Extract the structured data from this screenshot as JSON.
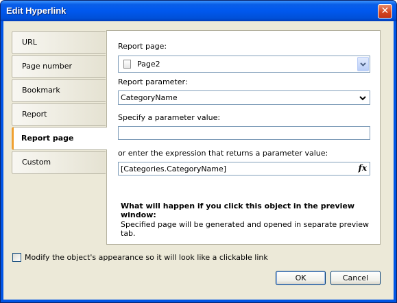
{
  "window": {
    "title": "Edit Hyperlink",
    "close_glyph": "✕"
  },
  "tabs": [
    {
      "label": "URL"
    },
    {
      "label": "Page number"
    },
    {
      "label": "Bookmark"
    },
    {
      "label": "Report"
    },
    {
      "label": "Report page",
      "active": true
    },
    {
      "label": "Custom"
    }
  ],
  "panel": {
    "report_page_label": "Report page:",
    "report_page_value": "Page2",
    "report_parameter_label": "Report parameter:",
    "report_parameter_value": "CategoryName",
    "param_value_label": "Specify a parameter value:",
    "param_value": "",
    "expression_label": "or enter the expression that returns a parameter value:",
    "expression_value": "[Categories.CategoryName]",
    "expression_button_glyph": "fx",
    "info_heading": "What will happen if you click this object in the preview window:",
    "info_text": "Specified page will be generated and opened in separate preview tab."
  },
  "options": {
    "modify_appearance_label": "Modify the object's appearance so it will look like a clickable link",
    "modify_appearance_checked": false
  },
  "buttons": {
    "ok": "OK",
    "cancel": "Cancel"
  },
  "colors": {
    "titlebar": "#0058ee",
    "dialog_bg": "#ece9d8",
    "active_tab_accent": "#f0a030",
    "input_border": "#7f9db9"
  }
}
